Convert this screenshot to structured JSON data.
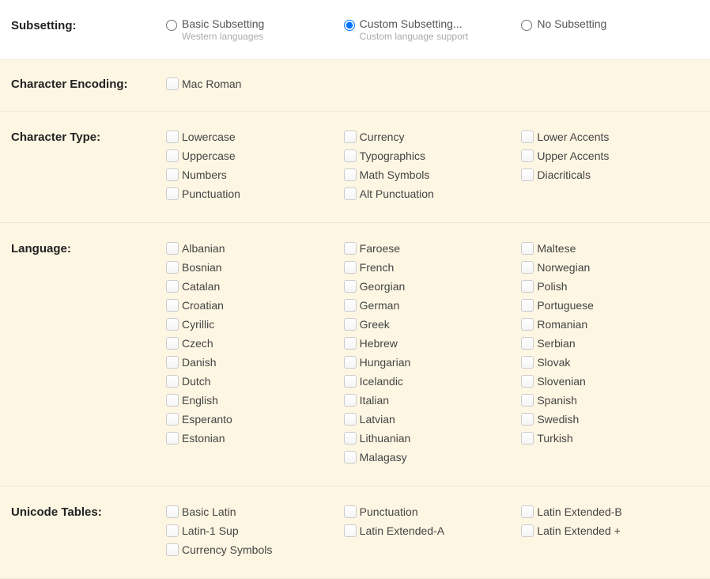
{
  "subsetting": {
    "label": "Subsetting:",
    "options": [
      {
        "title": "Basic Subsetting",
        "sub": "Western languages",
        "checked": false
      },
      {
        "title": "Custom Subsetting...",
        "sub": "Custom language support",
        "checked": true
      },
      {
        "title": "No Subsetting",
        "sub": "",
        "checked": false
      }
    ]
  },
  "character_encoding": {
    "label": "Character Encoding:",
    "items": [
      "Mac Roman"
    ]
  },
  "character_type": {
    "label": "Character Type:",
    "cols": [
      [
        "Lowercase",
        "Uppercase",
        "Numbers",
        "Punctuation"
      ],
      [
        "Currency",
        "Typographics",
        "Math Symbols",
        "Alt Punctuation"
      ],
      [
        "Lower Accents",
        "Upper Accents",
        "Diacriticals"
      ]
    ]
  },
  "language": {
    "label": "Language:",
    "cols": [
      [
        "Albanian",
        "Bosnian",
        "Catalan",
        "Croatian",
        "Cyrillic",
        "Czech",
        "Danish",
        "Dutch",
        "English",
        "Esperanto",
        "Estonian"
      ],
      [
        "Faroese",
        "French",
        "Georgian",
        "German",
        "Greek",
        "Hebrew",
        "Hungarian",
        "Icelandic",
        "Italian",
        "Latvian",
        "Lithuanian",
        "Malagasy"
      ],
      [
        "Maltese",
        "Norwegian",
        "Polish",
        "Portuguese",
        "Romanian",
        "Serbian",
        "Slovak",
        "Slovenian",
        "Spanish",
        "Swedish",
        "Turkish"
      ]
    ]
  },
  "unicode_tables": {
    "label": "Unicode Tables:",
    "cols": [
      [
        "Basic Latin",
        "Latin-1 Sup",
        "Currency Symbols"
      ],
      [
        "Punctuation",
        "Latin Extended-A"
      ],
      [
        "Latin Extended-B",
        "Latin Extended +"
      ]
    ]
  }
}
